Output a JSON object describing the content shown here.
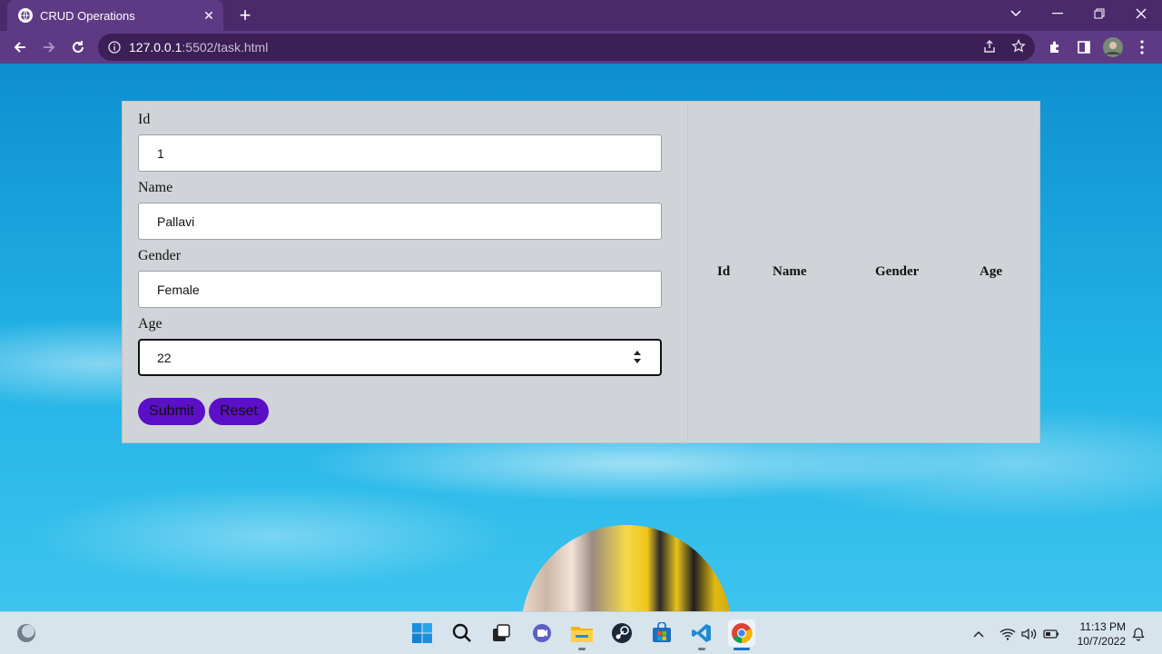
{
  "browser": {
    "tab_title": "CRUD Operations",
    "tab_close": "✕",
    "new_tab": "+",
    "url_host": "127.0.0.1",
    "url_path": ":5502/task.html"
  },
  "form": {
    "fields": [
      {
        "label": "Id",
        "value": "1"
      },
      {
        "label": "Name",
        "value": "Pallavi"
      },
      {
        "label": "Gender",
        "value": "Female"
      },
      {
        "label": "Age",
        "value": "22"
      }
    ],
    "submit_label": "Submit",
    "reset_label": "Reset",
    "button_color": "#5b0fc6"
  },
  "table": {
    "headers": [
      "Id",
      "Name",
      "Gender",
      "Age"
    ],
    "rows": []
  },
  "taskbar": {
    "time": "11:13 PM",
    "date": "10/7/2022"
  }
}
